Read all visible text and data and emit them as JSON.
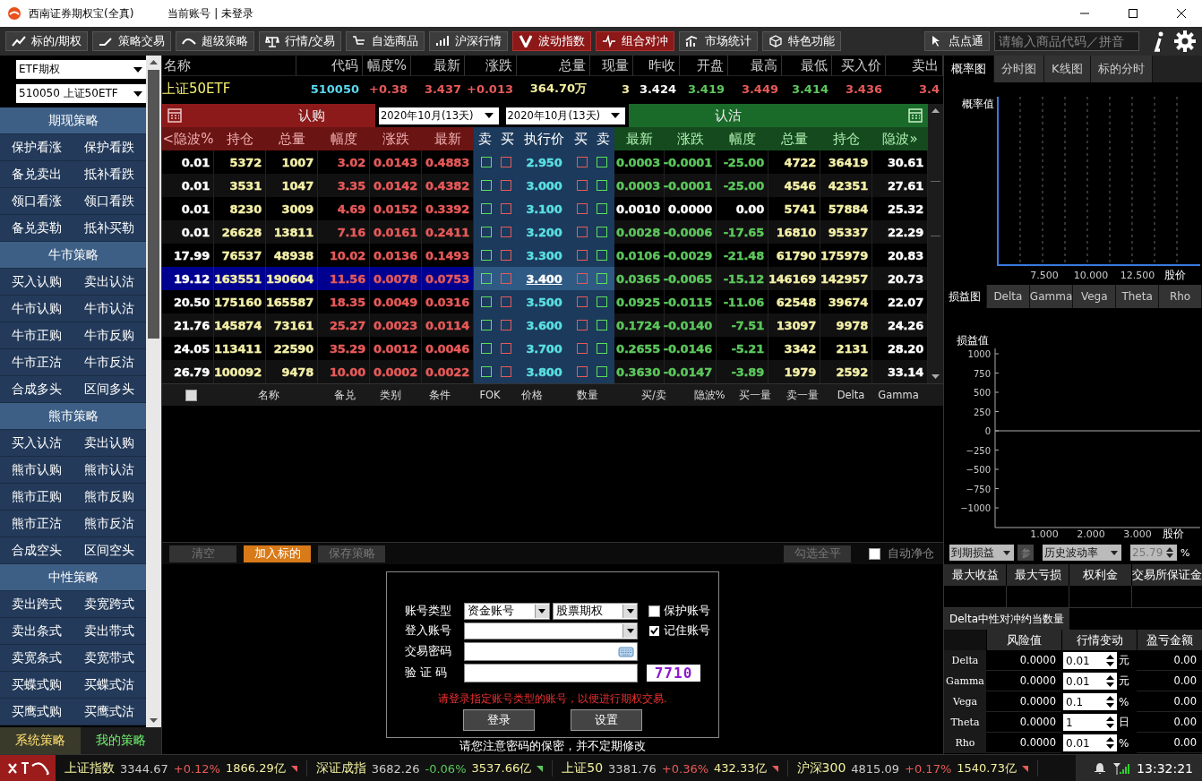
{
  "window": {
    "title": "西南证券期权宝(全真)",
    "account": "当前账号 | 未登录"
  },
  "toolbar": {
    "buttons": [
      {
        "label": "标的/期权",
        "highlighted": false
      },
      {
        "label": "策略交易",
        "highlighted": false
      },
      {
        "label": "超级策略",
        "highlighted": false
      },
      {
        "label": "行情/交易",
        "highlighted": false
      },
      {
        "label": "自选商品",
        "highlighted": false
      },
      {
        "label": "沪深行情",
        "highlighted": false
      },
      {
        "label": "波动指数",
        "highlighted": true
      },
      {
        "label": "组合对冲",
        "highlighted": true
      },
      {
        "label": "市场统计",
        "highlighted": false
      },
      {
        "label": "特色功能",
        "highlighted": false
      }
    ],
    "quick_button": "点点通",
    "search": {
      "placeholder": "请输入商品代码／拼音"
    }
  },
  "sidebar": {
    "selects": [
      "ETF期权",
      "510050 上证50ETF"
    ],
    "groups": [
      {
        "title": "期现策略",
        "items": [
          "保护看涨",
          "保护看跌",
          "备兑卖出",
          "抵补看跌",
          "领口看涨",
          "领口看跌",
          "备兑卖勒",
          "抵补买勒"
        ]
      },
      {
        "title": "牛市策略",
        "items": [
          "买入认购",
          "卖出认沽",
          "牛市认购",
          "牛市认沽",
          "牛市正购",
          "牛市反购",
          "牛市正沽",
          "牛市反沽",
          "合成多头",
          "区间多头"
        ]
      },
      {
        "title": "熊市策略",
        "items": [
          "买入认沽",
          "卖出认购",
          "熊市认购",
          "熊市认沽",
          "熊市正购",
          "熊市反购",
          "熊市正沽",
          "熊市反沽",
          "合成空头",
          "区间空头"
        ]
      },
      {
        "title": "中性策略",
        "items": [
          "卖出跨式",
          "卖宽跨式",
          "卖出条式",
          "卖出带式",
          "卖宽条式",
          "卖宽带式",
          "买蝶式购",
          "买蝶式沽",
          "买鹰式购",
          "买鹰式沽"
        ]
      }
    ],
    "tabs": [
      {
        "label": "系统策略",
        "selected": true
      },
      {
        "label": "我的策略",
        "selected": false
      }
    ]
  },
  "quote": [
    {
      "label": "名称",
      "value": "上证50ETF",
      "color": "#f4f070"
    },
    {
      "label": "代码",
      "value": "510050",
      "color": "#5ad8f0"
    },
    {
      "label": "幅度%",
      "value": "+0.38",
      "color": "#e85a5a"
    },
    {
      "label": "最新",
      "value": "3.437",
      "color": "#e85a5a"
    },
    {
      "label": "涨跌",
      "value": "+0.013",
      "color": "#e85a5a"
    },
    {
      "label": "总量",
      "value": "364.70万",
      "color": "#f4f0a0"
    },
    {
      "label": "现量",
      "value": "3",
      "color": "#f4f0a0"
    },
    {
      "label": "昨收",
      "value": "3.424",
      "color": "#ffffff"
    },
    {
      "label": "开盘",
      "value": "3.419",
      "color": "#5cc85c"
    },
    {
      "label": "最高",
      "value": "3.449",
      "color": "#e85a5a"
    },
    {
      "label": "最低",
      "value": "3.414",
      "color": "#5cc85c"
    },
    {
      "label": "买入价",
      "value": "3.436",
      "color": "#e85a5a"
    },
    {
      "label": "卖出",
      "value": "3.4",
      "color": "#e85a5a"
    }
  ],
  "option_chain": {
    "call_title": "认购",
    "put_title": "认沽",
    "expiries": [
      "2020年10月(13天)",
      "2020年10月(13天)"
    ],
    "call_columns": [
      {
        "label": "<隐波%",
        "kind": "iv"
      },
      {
        "label": "持仓",
        "kind": "volume"
      },
      {
        "label": "总量",
        "kind": "volume"
      },
      {
        "label": "幅度",
        "kind": "price"
      },
      {
        "label": "涨跌",
        "kind": "price"
      },
      {
        "label": "最新",
        "kind": "price"
      }
    ],
    "middle_columns": [
      "卖",
      "买",
      "执行价",
      "买",
      "卖"
    ],
    "put_columns": [
      {
        "label": "最新",
        "kind": "price"
      },
      {
        "label": "涨跌",
        "kind": "price"
      },
      {
        "label": "幅度",
        "kind": "price"
      },
      {
        "label": "总量",
        "kind": "volume"
      },
      {
        "label": "持仓",
        "kind": "volume"
      },
      {
        "label": "隐波»",
        "kind": "iv"
      }
    ],
    "rows": [
      {
        "call": {
          "values": [
            "0.01",
            "5372",
            "1007",
            "3.02",
            "0.0143",
            "0.4883"
          ]
        },
        "strike": "2.950",
        "put": {
          "values": [
            "0.0003",
            "-0.0001",
            "-25.00",
            "4722",
            "36419",
            "30.61"
          ],
          "flat": false
        },
        "selected": false
      },
      {
        "call": {
          "values": [
            "0.01",
            "3531",
            "1047",
            "3.35",
            "0.0142",
            "0.4382"
          ]
        },
        "strike": "3.000",
        "put": {
          "values": [
            "0.0003",
            "-0.0001",
            "-25.00",
            "4546",
            "42351",
            "27.61"
          ],
          "flat": false
        },
        "selected": false
      },
      {
        "call": {
          "values": [
            "0.01",
            "8230",
            "3009",
            "4.69",
            "0.0152",
            "0.3392"
          ]
        },
        "strike": "3.100",
        "put": {
          "values": [
            "0.0010",
            "0.0000",
            "0.00",
            "5741",
            "57884",
            "25.32"
          ],
          "flat": true
        },
        "selected": false
      },
      {
        "call": {
          "values": [
            "0.01",
            "26628",
            "13811",
            "7.16",
            "0.0161",
            "0.2411"
          ]
        },
        "strike": "3.200",
        "put": {
          "values": [
            "0.0028",
            "-0.0006",
            "-17.65",
            "16810",
            "95337",
            "22.29"
          ],
          "flat": false
        },
        "selected": false
      },
      {
        "call": {
          "values": [
            "17.99",
            "76537",
            "48938",
            "10.02",
            "0.0136",
            "0.1493"
          ]
        },
        "strike": "3.300",
        "put": {
          "values": [
            "0.0106",
            "-0.0029",
            "-21.48",
            "61790",
            "175979",
            "20.83"
          ],
          "flat": false
        },
        "selected": false
      },
      {
        "call": {
          "values": [
            "19.12",
            "163551",
            "190604",
            "11.56",
            "0.0078",
            "0.0753"
          ]
        },
        "strike": "3.400",
        "put": {
          "values": [
            "0.0365",
            "-0.0065",
            "-15.12",
            "146169",
            "142957",
            "20.73"
          ],
          "flat": false
        },
        "selected": true
      },
      {
        "call": {
          "values": [
            "20.50",
            "175160",
            "165587",
            "18.35",
            "0.0049",
            "0.0316"
          ]
        },
        "strike": "3.500",
        "put": {
          "values": [
            "0.0925",
            "-0.0115",
            "-11.06",
            "62548",
            "39674",
            "22.07"
          ],
          "flat": false
        },
        "selected": false
      },
      {
        "call": {
          "values": [
            "21.76",
            "145874",
            "73161",
            "25.27",
            "0.0023",
            "0.0114"
          ]
        },
        "strike": "3.600",
        "put": {
          "values": [
            "0.1724",
            "-0.0140",
            "-7.51",
            "13097",
            "9978",
            "24.26"
          ],
          "flat": false
        },
        "selected": false
      },
      {
        "call": {
          "values": [
            "24.05",
            "113411",
            "22590",
            "35.29",
            "0.0012",
            "0.0046"
          ]
        },
        "strike": "3.700",
        "put": {
          "values": [
            "0.2655",
            "-0.0146",
            "-5.21",
            "3342",
            "2131",
            "28.20"
          ],
          "flat": false
        },
        "selected": false
      },
      {
        "call": {
          "values": [
            "26.79",
            "100092",
            "9478",
            "10.00",
            "0.0002",
            "0.0022"
          ]
        },
        "strike": "3.800",
        "put": {
          "values": [
            "0.3630",
            "-0.0147",
            "-3.89",
            "1979",
            "2592",
            "33.14"
          ],
          "flat": false
        },
        "selected": false
      }
    ]
  },
  "strategy_table": {
    "all_checked": false,
    "columns": [
      "名称",
      "备兑",
      "类别",
      "条件",
      "FOK",
      "价格",
      "数量",
      "买/卖",
      "隐波%",
      "买一量",
      "卖一量",
      "Delta",
      "Gamma"
    ]
  },
  "actions": {
    "buttons": [
      {
        "label": "清空",
        "kind": "plain",
        "disabled": true
      },
      {
        "label": "加入标的",
        "kind": "primary",
        "disabled": false
      },
      {
        "label": "保存策略",
        "kind": "plain",
        "disabled": true
      }
    ],
    "close_all": {
      "label": "勾选全平",
      "disabled": true
    },
    "auto_net": {
      "label": "自动净仓",
      "checked": false
    }
  },
  "login": {
    "account_type": {
      "label": "账号类型",
      "values": [
        "资金账号",
        "股票期权"
      ]
    },
    "account": {
      "label": "登入账号"
    },
    "password": {
      "label": "交易密码"
    },
    "captcha": {
      "label": "验 证 码",
      "code": "7710"
    },
    "options": [
      {
        "label": "保护账号",
        "checked": false
      },
      {
        "label": "记住账号",
        "checked": true
      }
    ],
    "message": "请登录指定账号类型的账号，以便进行期权交易.",
    "buttons": [
      "登录",
      "设置"
    ],
    "note": "请您注意密码的保密，并不定期修改"
  },
  "right_panel": {
    "chart_tabs": [
      {
        "label": "概率图",
        "selected": true
      },
      {
        "label": "分时图",
        "selected": false
      },
      {
        "label": "K线图",
        "selected": false
      },
      {
        "label": "标的分时",
        "selected": false
      }
    ],
    "prob_chart": {
      "ylabel": "概率值",
      "xticks": [
        "7.500",
        "10.000",
        "12.500"
      ],
      "xlabel": "股价"
    },
    "pnl_tabs": [
      {
        "label": "损益图",
        "selected": true
      },
      {
        "label": "Delta",
        "selected": false
      },
      {
        "label": "Gamma",
        "selected": false
      },
      {
        "label": "Vega",
        "selected": false
      },
      {
        "label": "Theta",
        "selected": false
      },
      {
        "label": "Rho",
        "selected": false
      }
    ],
    "pnl_chart": {
      "ylabel": "损益值",
      "yticks": [
        "1000",
        "750",
        "500",
        "250",
        "0",
        "−250",
        "−500",
        "−750",
        "−1000"
      ],
      "xticks": [
        "1.000",
        "2.000",
        "3.000"
      ],
      "xlabel": "股价"
    },
    "controls": {
      "mode": "到期损益",
      "param_button": "参",
      "vol_source": "历史波动率",
      "vol_value": "25.79",
      "vol_unit": "%"
    },
    "summary_columns": [
      "最大收益",
      "最大亏损",
      "权利金",
      "交易所保证金"
    ],
    "hedge_label": "Delta中性对冲约当数量",
    "greeks": {
      "columns": [
        "风险值",
        "行情变动",
        "盈亏金额"
      ],
      "rows": [
        {
          "name": "Delta",
          "risk": "0.0000",
          "step": "0.01",
          "unit": "元",
          "pnl": "0.00"
        },
        {
          "name": "Gamma",
          "risk": "0.0000",
          "step": "0.01",
          "unit": "元",
          "pnl": "0.00"
        },
        {
          "name": "Vega",
          "risk": "0.0000",
          "step": "0.1",
          "unit": "%",
          "pnl": "0.00"
        },
        {
          "name": "Theta",
          "risk": "0.0000",
          "step": "1",
          "unit": "日",
          "pnl": "0.00"
        },
        {
          "name": "Rho",
          "risk": "0.0000",
          "step": "0.01",
          "unit": "%",
          "pnl": "0.00"
        }
      ]
    }
  },
  "status_bar": {
    "indices": [
      {
        "name": "上证指数",
        "price": "3344.67",
        "change": "+0.12%",
        "volume": "1866.29亿",
        "color": "#e85a5a"
      },
      {
        "name": "深证成指",
        "price": "3682.26",
        "change": "-0.06%",
        "volume": "3537.66亿",
        "color": "#5cc85c"
      },
      {
        "name": "上证50",
        "price": "3381.76",
        "change": "+0.36%",
        "volume": "432.33亿",
        "color": "#e85a5a"
      },
      {
        "name": "沪深300",
        "price": "4815.09",
        "change": "+0.17%",
        "volume": "1540.73亿",
        "color": "#e85a5a"
      }
    ],
    "time": "13:32:21"
  }
}
